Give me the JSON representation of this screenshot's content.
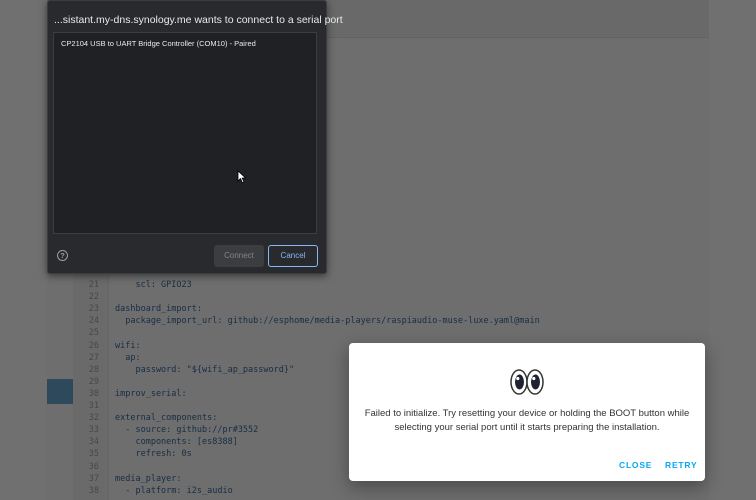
{
  "serial_dialog": {
    "title": "...sistant.my-dns.synology.me wants to connect to a serial port",
    "ports": [
      "CP2104 USB to UART Bridge Controller (COM10) - Paired"
    ],
    "connect_label": "Connect",
    "cancel_label": "Cancel",
    "help_glyph": "?"
  },
  "editor": {
    "lines": [
      {
        "n": "21",
        "text": "    scl: GPIO23"
      },
      {
        "n": "22",
        "text": ""
      },
      {
        "n": "23",
        "text": "dashboard_import:"
      },
      {
        "n": "24",
        "text": "  package_import_url: github://esphome/media-players/raspiaudio-muse-luxe.yaml@main"
      },
      {
        "n": "25",
        "text": ""
      },
      {
        "n": "26",
        "text": "wifi:"
      },
      {
        "n": "27",
        "text": "  ap:"
      },
      {
        "n": "28",
        "text": "    password: \"${wifi_ap_password}\""
      },
      {
        "n": "29",
        "text": ""
      },
      {
        "n": "30",
        "text": "improv_serial:"
      },
      {
        "n": "31",
        "text": ""
      },
      {
        "n": "32",
        "text": "external_components:"
      },
      {
        "n": "33",
        "text": "  - source: github://pr#3552"
      },
      {
        "n": "34",
        "text": "    components: [es8388]"
      },
      {
        "n": "35",
        "text": "    refresh: 0s"
      },
      {
        "n": "36",
        "text": ""
      },
      {
        "n": "37",
        "text": "media_player:"
      },
      {
        "n": "38",
        "text": "  - platform: i2s_audio"
      }
    ]
  },
  "error_dialog": {
    "message": "Failed to initialize. Try resetting your device or holding the BOOT button while selecting your serial port until it starts preparing the installation.",
    "close_label": "CLOSE",
    "retry_label": "RETRY",
    "icon": "eyes-icon"
  },
  "colors": {
    "accent": "#03a9f4",
    "chooser_bg": "#292a2d",
    "chooser_link": "#8ab4f8",
    "code": "#3b6a9e"
  }
}
